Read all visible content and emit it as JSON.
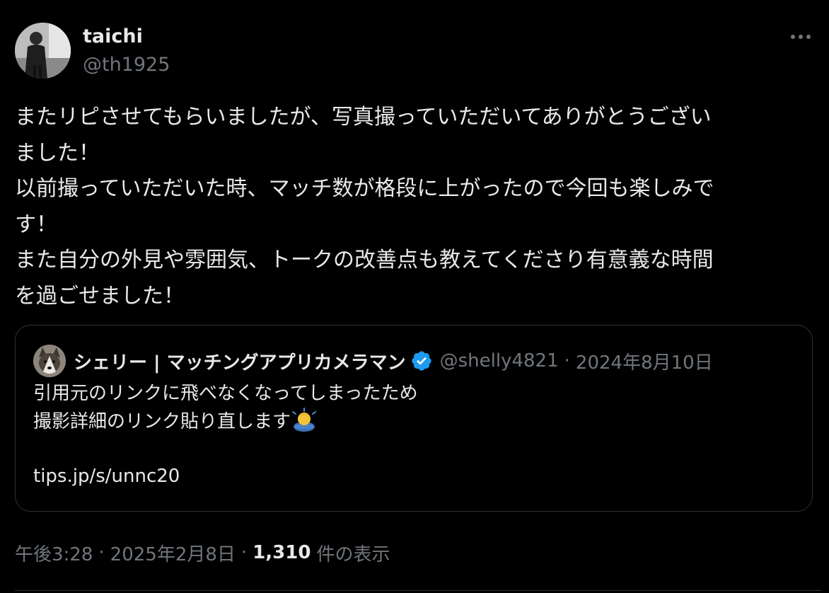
{
  "author": {
    "display_name": "taichi",
    "handle": "@th1925"
  },
  "tweet": {
    "lines": [
      "またリピさせてもらいましたが、写真撮っていただいてありがとうござい",
      "ました！",
      "以前撮っていただいた時、マッチ数が格段に上がったので今回も楽しみで",
      "す！",
      "また自分の外見や雰囲気、トークの改善点も教えてくださり有意義な時間",
      "を過ごせました！"
    ]
  },
  "quote": {
    "name": "シェリー | マッチングアプリカメラマン",
    "handle": "@shelly4821",
    "separator": "·",
    "date": "2024年8月10日",
    "line1": "引用元のリンクに飛べなくなってしまったため",
    "line2": "撮影詳細のリンク貼り直します",
    "link": "tips.jp/s/unnc20"
  },
  "meta": {
    "time": "午後3:28",
    "sep1": "·",
    "date": "2025年2月8日",
    "sep2": "·",
    "views_count": "1,310",
    "views_label": "件の表示"
  },
  "icons": {
    "more": "more-horizontal-icon",
    "verified": "verified-badge-icon",
    "bow_emoji": "person-bowing-emoji"
  },
  "colors": {
    "background": "#000000",
    "text": "#e7e9ea",
    "muted": "#71767b",
    "border": "#2f3336",
    "verified": "#1d9bf0"
  }
}
